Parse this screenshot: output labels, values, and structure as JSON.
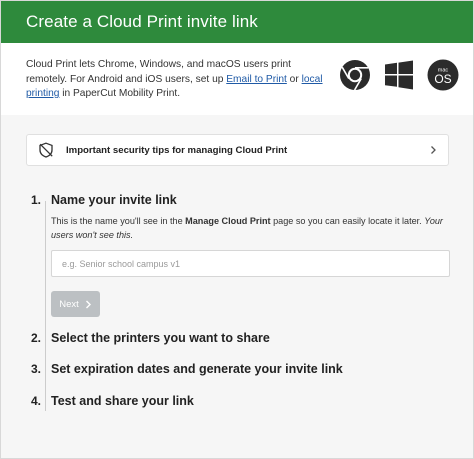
{
  "header": {
    "title": "Create a Cloud Print invite link"
  },
  "intro": {
    "text_before": "Cloud Print lets Chrome, Windows, and macOS users print remotely. For Android and iOS users, set up ",
    "link1": "Email to Print",
    "text_middle": " or ",
    "link2": "local printing",
    "text_after": " in PaperCut Mobility Print."
  },
  "os_icons": {
    "macos_top": "mac",
    "macos_bottom": "OS"
  },
  "tips": {
    "label": "Important security tips for managing Cloud Print"
  },
  "steps": [
    {
      "number": "1.",
      "title": "Name your invite link",
      "desc_before": "This is the name you'll see in the ",
      "desc_bold": "Manage Cloud Print",
      "desc_middle": " page so you can easily locate it later. ",
      "desc_italic": "Your users won't see this.",
      "input_placeholder": "e.g. Senior school campus v1",
      "next_label": "Next"
    },
    {
      "number": "2.",
      "title": "Select the printers you want to share"
    },
    {
      "number": "3.",
      "title": "Set expiration dates and generate your invite link"
    },
    {
      "number": "4.",
      "title": "Test and share your link"
    }
  ],
  "colors": {
    "header_bg": "#2e8a3c",
    "link": "#1f5aa6",
    "panel_bg": "#f6f6f6",
    "next_button_disabled": "#bcc0c3"
  }
}
